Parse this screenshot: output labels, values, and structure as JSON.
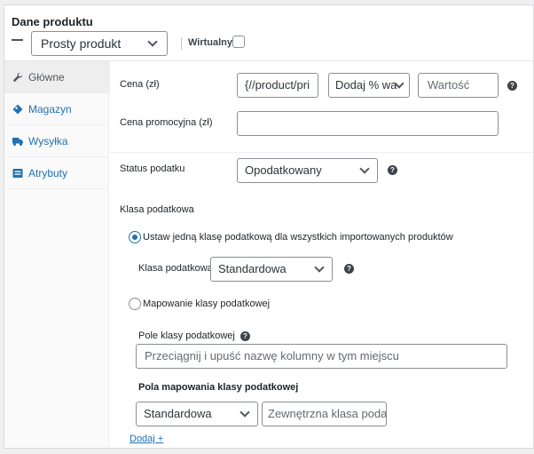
{
  "header": {
    "title": "Dane produktu",
    "product_type": "Prosty produkt",
    "virtual_label": "Wirtualny"
  },
  "tabs": [
    {
      "label": "Główne",
      "icon": "wrench-icon"
    },
    {
      "label": "Magazyn",
      "icon": "diamond-icon"
    },
    {
      "label": "Wysyłka",
      "icon": "truck-icon"
    },
    {
      "label": "Atrybuty",
      "icon": "list-icon"
    }
  ],
  "general": {
    "price_label": "Cena (zł)",
    "price_value": "{//product/pri",
    "price_modifier": "Dodaj % wa",
    "price_amount_placeholder": "Wartość",
    "sale_price_label": "Cena promocyjna (zł)",
    "sale_price_value": "",
    "tax_status_label": "Status podatku",
    "tax_status_value": "Opodatkowany",
    "tax_class_heading": "Klasa podatkowa",
    "option_single_label": "Ustaw jedną klasę podatkową dla wszystkich importowanych produktów",
    "tax_class_label": "Klasa podatkowa",
    "tax_class_value": "Standardowa",
    "option_mapping_label": "Mapowanie klasy podatkowej",
    "tax_field_label": "Pole klasy podatkowej",
    "tax_field_placeholder": "Przeciągnij i upuść nazwę kolumny w tym miejscu",
    "mapping_heading": "Pola mapowania klasy podatkowej",
    "mapping_select_value": "Standardowa",
    "mapping_external_placeholder": "Zewnętrzna klasa poda",
    "add_link": "Dodaj +"
  },
  "colors": {
    "link": "#2271b1",
    "border": "#8c8f94",
    "active_tab": "#eeeeee"
  }
}
